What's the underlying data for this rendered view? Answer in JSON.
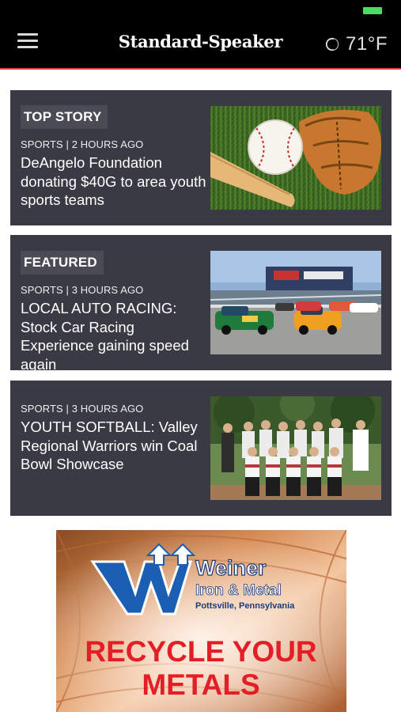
{
  "app": {
    "masthead": "Standard-Speaker"
  },
  "weather": {
    "temperature": "71°F",
    "icon": "moon-icon"
  },
  "stories": [
    {
      "badge": "TOP STORY",
      "meta": "SPORTS | 2 HOURS AGO",
      "headline": "DeAngelo Foundation donating $40G to area youth sports teams",
      "image": "baseball-bat-glove-photo"
    },
    {
      "badge": "FEATURED",
      "meta": "SPORTS | 3 HOURS AGO",
      "headline": "LOCAL AUTO RACING: Stock Car Racing Experience gaining speed again",
      "image": "stock-car-race-photo"
    },
    {
      "badge": "",
      "meta": "SPORTS | 3 HOURS AGO",
      "headline": "YOUTH SOFTBALL: Valley Regional Warriors win Coal Bowl Showcase",
      "image": "softball-team-photo"
    }
  ],
  "ad": {
    "brand_line1": "Weiner",
    "brand_line2": "Iron & Metal",
    "brand_location": "Pottsville, Pennsylvania",
    "tagline_line1": "RECYCLE YOUR",
    "tagline_line2": "METALS"
  },
  "colors": {
    "nav_background": "#000000",
    "nav_accent": "#d9463b",
    "card_background": "#3a3a44",
    "badge_background": "#4b4b55",
    "ad_red": "#e41e26",
    "ad_blue": "#1a5fb4"
  }
}
